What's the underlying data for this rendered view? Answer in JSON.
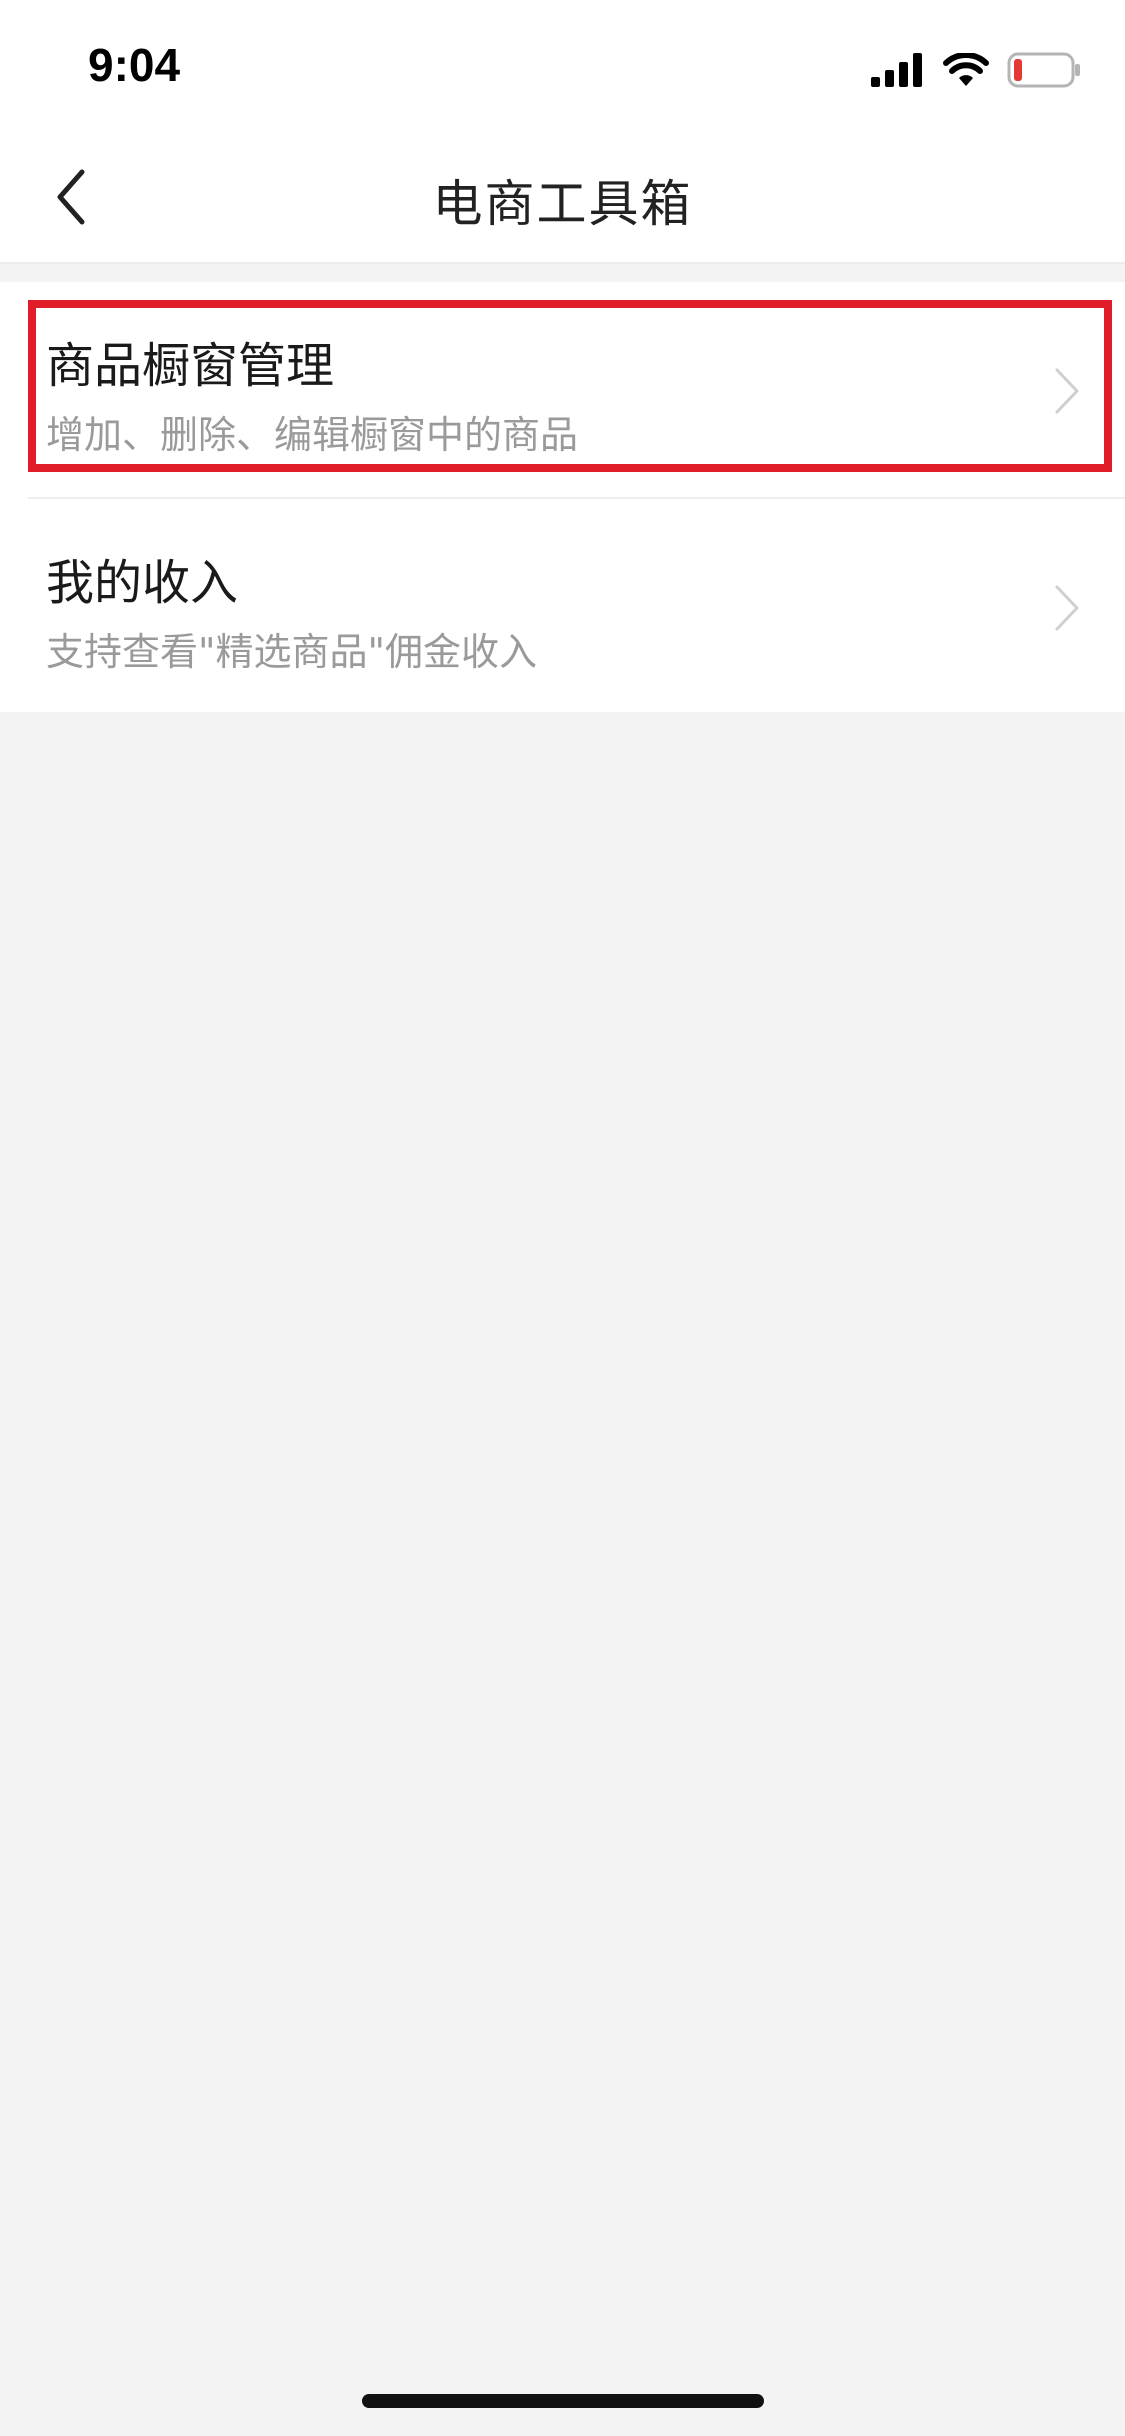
{
  "status_bar": {
    "time": "9:04",
    "icons": [
      "signal-icon",
      "wifi-icon",
      "battery-low-icon"
    ],
    "battery_color": "#e53935"
  },
  "nav": {
    "title": "电商工具箱",
    "back_icon": "chevron-left-icon"
  },
  "list": {
    "items": [
      {
        "title": "商品橱窗管理",
        "subtitle": "增加、删除、编辑橱窗中的商品",
        "icon": "chevron-right-icon",
        "highlighted": true
      },
      {
        "title": "我的收入",
        "subtitle": "支持查看\"精选商品\"佣金收入",
        "icon": "chevron-right-icon",
        "highlighted": false
      }
    ]
  },
  "colors": {
    "highlight": "#e11d2a",
    "background": "#f3f3f3",
    "subtitle": "#9a9a9a"
  }
}
